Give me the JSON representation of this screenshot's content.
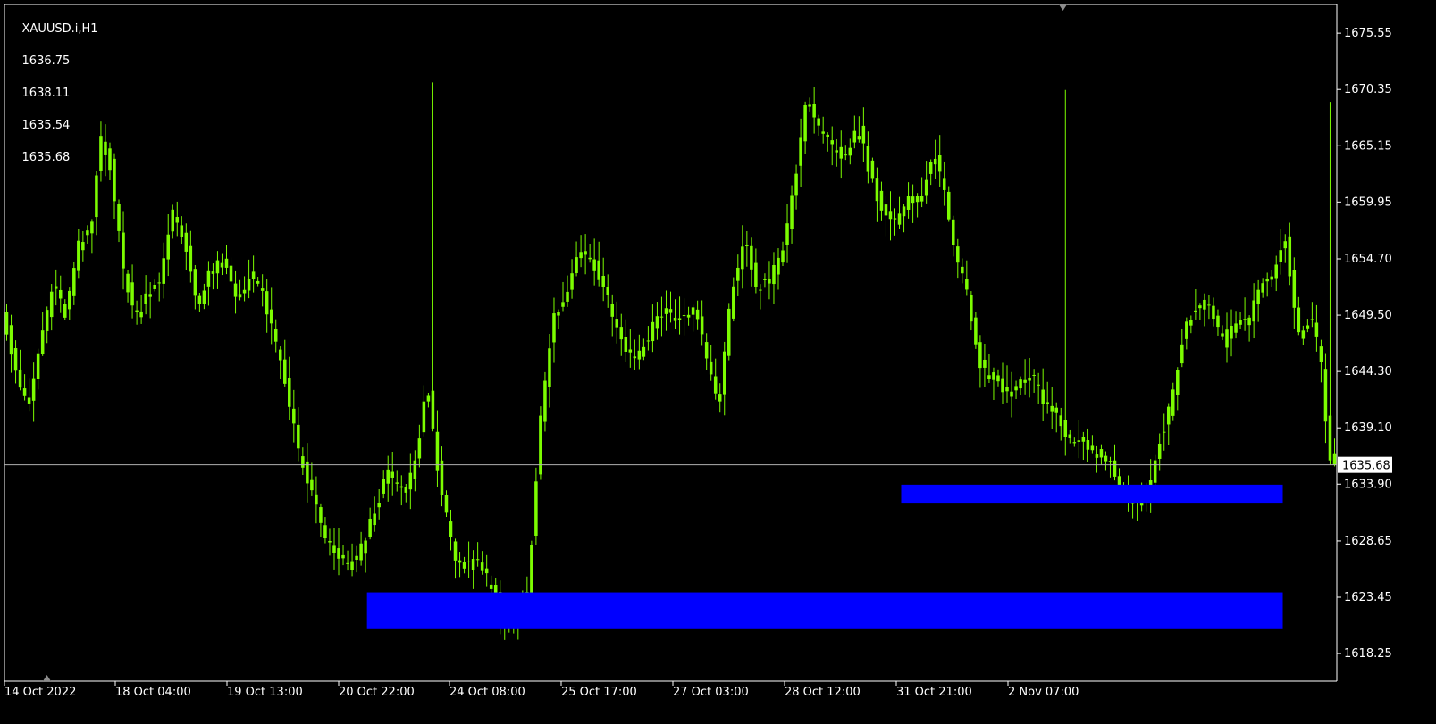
{
  "window": {
    "symbol": "XAUUSD.i,H1",
    "ohlc": {
      "open": "1636.75",
      "high": "1638.11",
      "low": "1635.54",
      "close": "1635.68"
    }
  },
  "colors": {
    "background": "#000000",
    "axis": "#ffffff",
    "grid_line": "#b0b0b0",
    "bull_candle": "#7CFC00",
    "bear_candle": "#7CFC00",
    "zone_fill": "#0000FF",
    "label_background": "#ffffff",
    "label_text": "#000000"
  },
  "chart_data": {
    "type": "candlestick",
    "symbol": "XAUUSD.i",
    "timeframe": "H1",
    "ylim": [
      1615.7,
      1678.2
    ],
    "y_ticks": [
      "1675.55",
      "1670.35",
      "1665.15",
      "1659.95",
      "1654.70",
      "1649.50",
      "1644.30",
      "1639.10",
      "1635.68",
      "1633.90",
      "1628.65",
      "1623.45",
      "1618.25"
    ],
    "x_ticks": [
      "14 Oct 2022",
      "18 Oct 04:00",
      "19 Oct 13:00",
      "20 Oct 22:00",
      "24 Oct 08:00",
      "25 Oct 17:00",
      "27 Oct 03:00",
      "28 Oct 12:00",
      "31 Oct 21:00",
      "2 Nov 07:00"
    ],
    "current_price": 1635.68,
    "current_price_label": "1635.68",
    "candle_count": 297,
    "path_points": [
      [
        0,
        1650.2
      ],
      [
        4,
        1644.8
      ],
      [
        8,
        1640.5
      ],
      [
        12,
        1647.0
      ],
      [
        16,
        1652.4
      ],
      [
        20,
        1649.5
      ],
      [
        24,
        1655.8
      ],
      [
        28,
        1657.2
      ],
      [
        31,
        1666.2
      ],
      [
        34,
        1663.4
      ],
      [
        38,
        1654.0
      ],
      [
        42,
        1649.2
      ],
      [
        46,
        1651.8
      ],
      [
        50,
        1653.0
      ],
      [
        54,
        1659.2
      ],
      [
        58,
        1655.5
      ],
      [
        62,
        1650.3
      ],
      [
        66,
        1653.8
      ],
      [
        70,
        1654.2
      ],
      [
        74,
        1651.0
      ],
      [
        78,
        1653.1
      ],
      [
        82,
        1651.7
      ],
      [
        86,
        1647.0
      ],
      [
        90,
        1642.2
      ],
      [
        94,
        1636.1
      ],
      [
        98,
        1632.8
      ],
      [
        102,
        1628.6
      ],
      [
        106,
        1627.3
      ],
      [
        110,
        1626.1
      ],
      [
        114,
        1628.4
      ],
      [
        118,
        1632.0
      ],
      [
        122,
        1635.1
      ],
      [
        126,
        1633.0
      ],
      [
        130,
        1635.3
      ],
      [
        134,
        1643.2
      ],
      [
        138,
        1634.1
      ],
      [
        142,
        1627.8
      ],
      [
        146,
        1626.2
      ],
      [
        150,
        1626.5
      ],
      [
        154,
        1624.6
      ],
      [
        158,
        1621.8
      ],
      [
        162,
        1621.1
      ],
      [
        166,
        1624.7
      ],
      [
        170,
        1640.4
      ],
      [
        174,
        1649.3
      ],
      [
        178,
        1651.1
      ],
      [
        182,
        1656.0
      ],
      [
        186,
        1654.6
      ],
      [
        190,
        1652.2
      ],
      [
        194,
        1648.3
      ],
      [
        198,
        1645.7
      ],
      [
        202,
        1646.3
      ],
      [
        206,
        1649.2
      ],
      [
        210,
        1650.0
      ],
      [
        214,
        1648.9
      ],
      [
        218,
        1650.4
      ],
      [
        222,
        1645.9
      ],
      [
        226,
        1640.9
      ],
      [
        230,
        1651.4
      ],
      [
        234,
        1656.5
      ],
      [
        238,
        1652.0
      ],
      [
        242,
        1652.8
      ],
      [
        246,
        1655.1
      ],
      [
        250,
        1661.6
      ],
      [
        254,
        1670.1
      ],
      [
        258,
        1666.2
      ],
      [
        262,
        1665.0
      ],
      [
        266,
        1664.0
      ],
      [
        270,
        1667.1
      ],
      [
        274,
        1662.3
      ],
      [
        278,
        1659.0
      ],
      [
        282,
        1657.9
      ],
      [
        286,
        1660.0
      ],
      [
        290,
        1660.7
      ],
      [
        294,
        1664.1
      ],
      [
        297,
        1661.8
      ],
      [
        301,
        1654.8
      ],
      [
        305,
        1650.6
      ],
      [
        309,
        1644.2
      ],
      [
        313,
        1643.6
      ],
      [
        317,
        1642.0
      ],
      [
        321,
        1643.2
      ],
      [
        325,
        1643.8
      ],
      [
        329,
        1641.2
      ],
      [
        333,
        1640.1
      ],
      [
        337,
        1638.0
      ],
      [
        341,
        1637.5
      ],
      [
        345,
        1636.6
      ],
      [
        349,
        1636.2
      ],
      [
        353,
        1633.8
      ],
      [
        357,
        1632.0
      ],
      [
        361,
        1632.9
      ],
      [
        365,
        1637.9
      ],
      [
        369,
        1641.4
      ],
      [
        373,
        1648.7
      ],
      [
        377,
        1650.2
      ],
      [
        381,
        1650.6
      ],
      [
        385,
        1647.0
      ],
      [
        389,
        1648.6
      ],
      [
        393,
        1649.1
      ],
      [
        397,
        1651.9
      ],
      [
        401,
        1653.6
      ],
      [
        405,
        1656.4
      ],
      [
        409,
        1647.5
      ],
      [
        413,
        1649.1
      ],
      [
        416,
        1645.4
      ],
      [
        419,
        1635.68
      ]
    ],
    "zones": [
      {
        "name": "demand-zone-upper",
        "x_start_index": 282,
        "x_end_index": 402,
        "y_low": 1632.1,
        "y_high": 1633.85
      },
      {
        "name": "demand-zone-lower",
        "x_start_index": 114,
        "x_end_index": 402,
        "y_low": 1620.5,
        "y_high": 1623.9
      }
    ],
    "spikes": [
      {
        "index": 135,
        "high": 1671.0
      },
      {
        "index": 334,
        "high": 1670.3
      },
      {
        "index": 417,
        "high": 1669.2
      }
    ],
    "scroll_markers": [
      "top-right",
      "bottom-left"
    ]
  }
}
